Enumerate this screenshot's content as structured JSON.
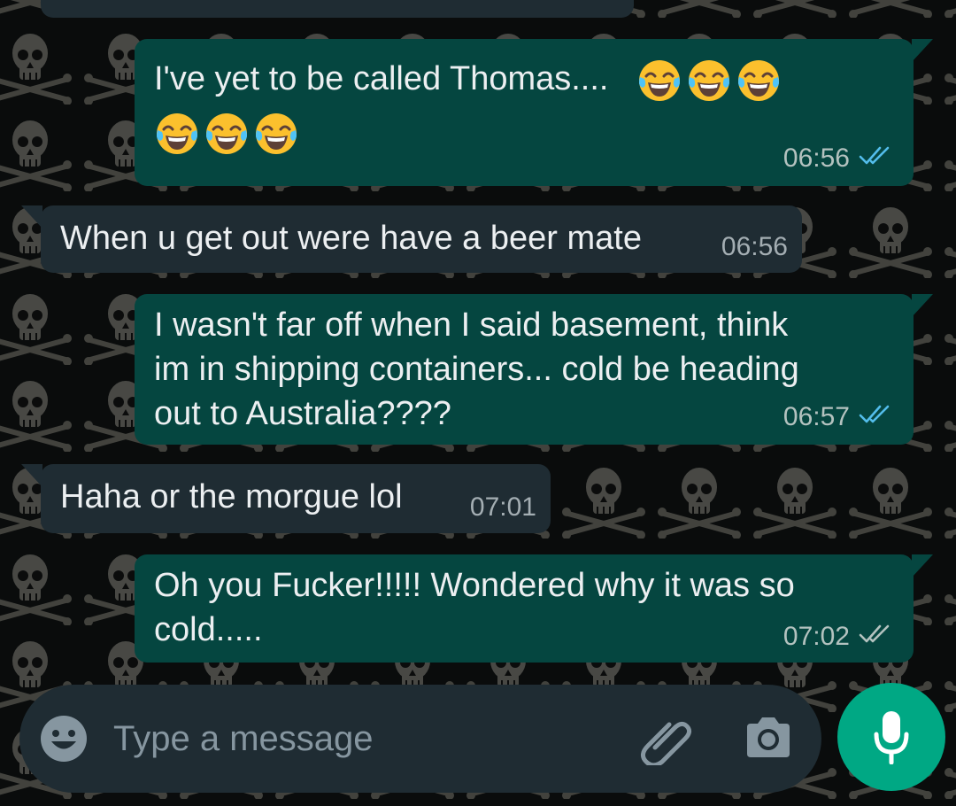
{
  "wallpaper": {
    "icon": "skull-crossbones-pattern"
  },
  "chat": {
    "messages": [
      {
        "direction": "outgoing",
        "text": "I've yet to be called Thomas....",
        "emoji_glyph": "😂",
        "emoji_name": "face-with-tears-of-joy",
        "emoji_count": 6,
        "time": "06:56",
        "status": "read",
        "status_icon": "double-check-blue-icon"
      },
      {
        "direction": "incoming",
        "text": "When u get out were have a beer mate",
        "time": "06:56"
      },
      {
        "direction": "outgoing",
        "lines": [
          "I wasn't far off when I said basement, think",
          "im in shipping containers...   cold be heading",
          "out to Australia????"
        ],
        "time": "06:57",
        "status": "read",
        "status_icon": "double-check-blue-icon"
      },
      {
        "direction": "incoming",
        "text": "Haha or the morgue lol",
        "time": "07:01"
      },
      {
        "direction": "outgoing",
        "lines": [
          "Oh you Fucker!!!!!   Wondered why it was so",
          "cold....."
        ],
        "time": "07:02",
        "status": "delivered",
        "status_icon": "double-check-grey-icon"
      }
    ]
  },
  "composer": {
    "placeholder": "Type a message",
    "emoji_icon": "smiley-icon",
    "attach_icon": "paperclip-icon",
    "camera_icon": "camera-icon",
    "mic_icon": "microphone-icon"
  },
  "colors": {
    "outgoing_bubble": "#054640",
    "incoming_bubble": "#1f2c33",
    "read_ticks": "#53bdeb",
    "delivered_ticks": "#b3c2bf",
    "mic_button": "#00a884"
  }
}
